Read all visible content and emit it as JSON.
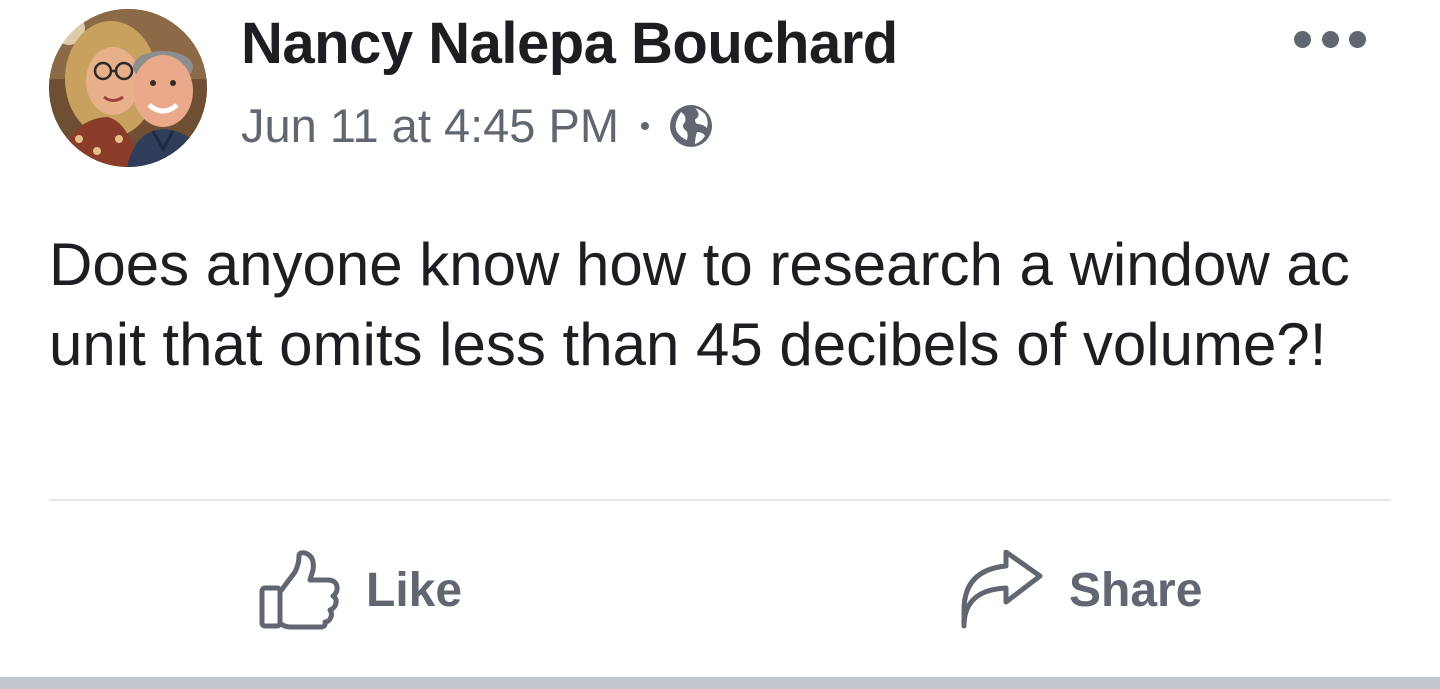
{
  "post": {
    "author": "Nancy Nalepa Bouchard",
    "timestamp": "Jun 11 at 4:45 PM",
    "privacy_icon": "globe-icon",
    "menu_icon": "more-options-icon",
    "text": "Does anyone know how to research a window ac unit that omits less than 45 decibels of volume?!"
  },
  "actions": {
    "like_label": "Like",
    "like_icon": "thumbs-up-icon",
    "share_label": "Share",
    "share_icon": "share-arrow-icon"
  },
  "colors": {
    "primary_text": "#1c1e21",
    "secondary_text": "#606770",
    "divider": "#e4e6eb",
    "bottom_bar": "#c4c8ce"
  }
}
